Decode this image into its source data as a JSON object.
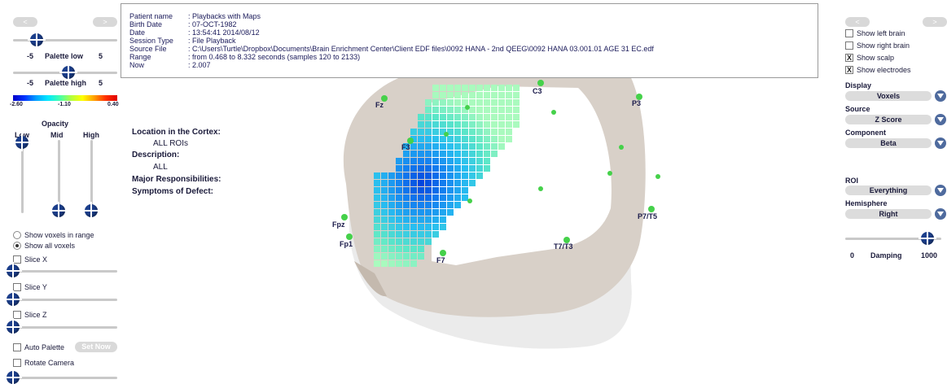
{
  "left_panel": {
    "nav_prev": "<",
    "nav_next": ">",
    "palette_low": {
      "label": "Palette low",
      "min": "-5",
      "max": "5"
    },
    "palette_high": {
      "label": "Palette high",
      "min": "-5",
      "max": "5"
    },
    "palette_scale": {
      "left": "-2.60",
      "mid": "-1.10",
      "right": "0.40"
    },
    "opacity": {
      "title": "Opacity",
      "low": "Low",
      "mid": "Mid",
      "high": "High"
    },
    "show_voxels_in_range": "Show voxels in range",
    "show_all_voxels": "Show all voxels",
    "slice_x": "Slice X",
    "slice_y": "Slice Y",
    "slice_z": "Slice Z",
    "auto_palette": "Auto Palette",
    "set_now": "Set Now",
    "rotate_camera": "Rotate Camera"
  },
  "info": {
    "patient_name_k": "Patient name",
    "patient_name_v": ": Playbacks with Maps",
    "birth_date_k": "Birth Date",
    "birth_date_v": ": 07-OCT-1982",
    "date_k": "Date",
    "date_v": ": 13:54:41 2014/08/12",
    "session_type_k": "Session Type",
    "session_type_v": ": File Playback",
    "source_file_k": "Source File",
    "source_file_v": ": C:\\Users\\Turtle\\Dropbox\\Documents\\Brain Enrichment Center\\Client EDF files\\0092 HANA - 2nd QEEG\\0092 HANA 03.001.01 AGE 31  EC.edf",
    "range_k": "Range",
    "range_v": ": from 0.468 to 8.332 seconds (samples 120 to 2133)",
    "now_k": "Now",
    "now_v": ": 2.007"
  },
  "cortex": {
    "location_label": "Location in the Cortex:",
    "location_value": "ALL ROIs",
    "description_label": "Description:",
    "description_value": "ALL",
    "responsibilities_label": "Major Responsibilities:",
    "symptoms_label": "Symptoms of Defect:"
  },
  "electrodes": {
    "fz": "Fz",
    "c3": "C3",
    "p3": "P3",
    "f3": "F3",
    "fpz": "Fpz",
    "fp1": "Fp1",
    "f7": "F7",
    "t7t3": "T7/T3",
    "p7t5": "P7/T5"
  },
  "right_panel": {
    "nav_prev": "<",
    "nav_next": ">",
    "show_left_brain": "Show left brain",
    "show_right_brain": "Show right brain",
    "show_scalp": "Show scalp",
    "show_electrodes": "Show electrodes",
    "checked_mark": "X",
    "display_label": "Display",
    "display_value": "Voxels",
    "source_label": "Source",
    "source_value": "Z Score",
    "component_label": "Component",
    "component_value": "Beta",
    "roi_label": "ROI",
    "roi_value": "Everything",
    "hemisphere_label": "Hemisphere",
    "hemisphere_value": "Right",
    "damping_label": "Damping",
    "damping_min": "0",
    "damping_max": "1000"
  },
  "colors": {
    "accent": "#1c3f8c",
    "electrode": "#45d14a",
    "scalp": "#d8d0c8",
    "head": "#ebebeb"
  }
}
